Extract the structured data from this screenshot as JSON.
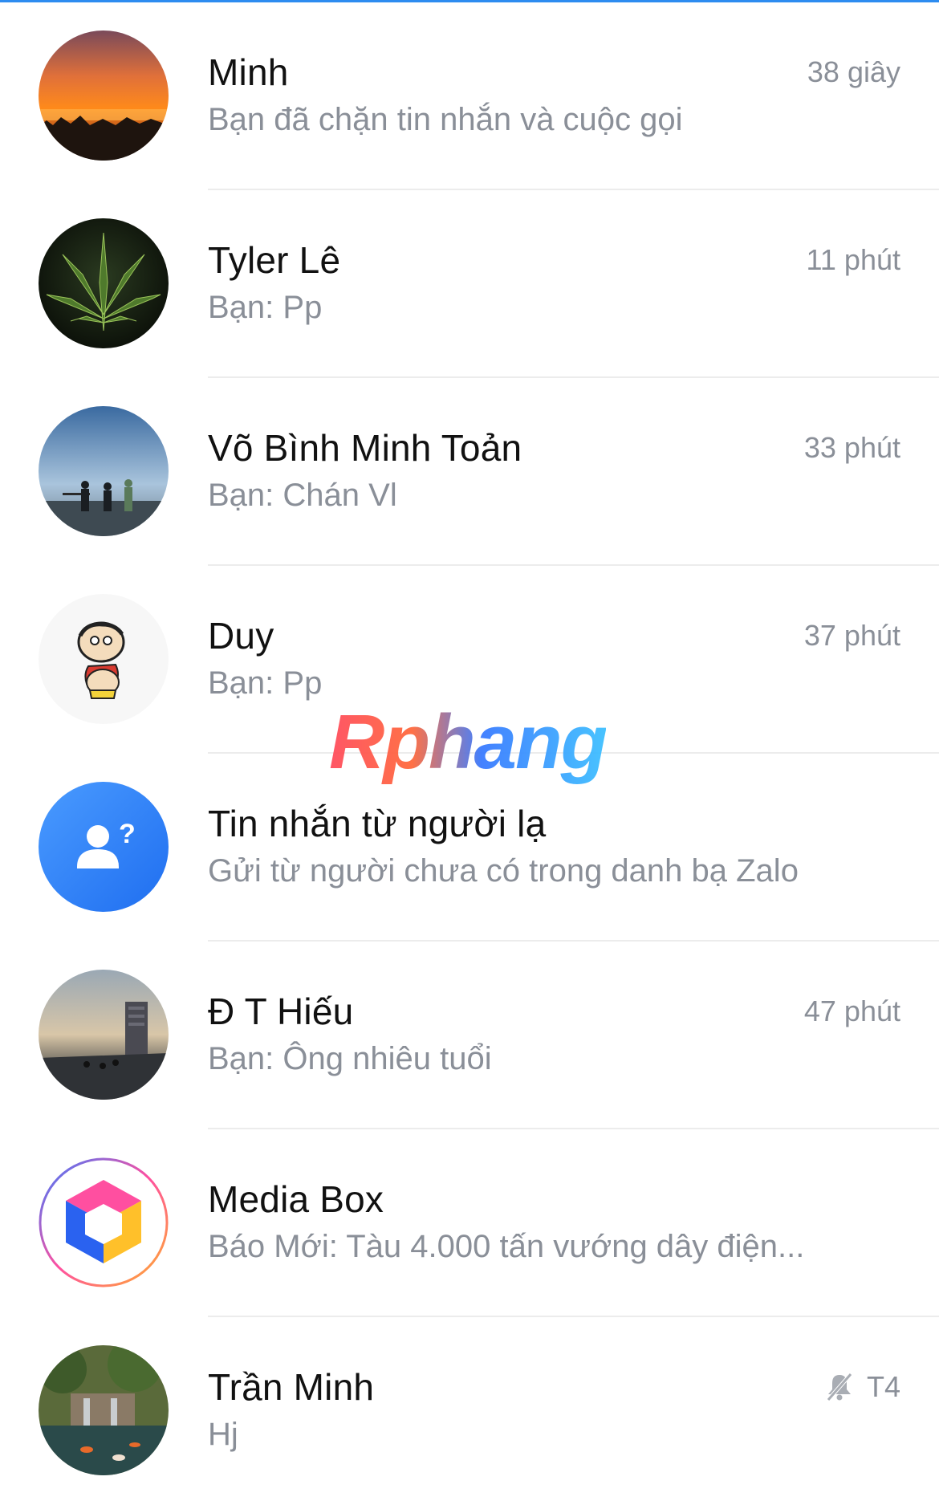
{
  "conversations": [
    {
      "name": "Minh",
      "preview": "Bạn đã chặn tin nhắn và cuộc gọi",
      "time": "38 giây",
      "avatar": "sunset-photo"
    },
    {
      "name": "Tyler Lê",
      "preview": "Bạn: Pp",
      "time": "11 phút",
      "avatar": "leaf-photo"
    },
    {
      "name": "Võ Bình Minh Toản",
      "preview": "Bạn: Chán Vl",
      "time": "33 phút",
      "avatar": "beach-people-photo"
    },
    {
      "name": "Duy",
      "preview": "Bạn: Pp",
      "time": "37 phút",
      "avatar": "cartoon-character"
    },
    {
      "name": "Tin nhắn từ người lạ",
      "preview": "Gửi từ người chưa có trong danh bạ Zalo",
      "time": "",
      "avatar": "unknown-person-icon"
    },
    {
      "name": "Đ T Hiếu",
      "preview": "Bạn: Ông nhiêu tuổi",
      "time": "47 phút",
      "avatar": "street-photo"
    },
    {
      "name": "Media Box",
      "preview": "Báo Mới: Tàu 4.000 tấn vướng dây điện...",
      "time": "",
      "avatar": "media-box-logo"
    },
    {
      "name": "Trần Minh",
      "preview": "Hj",
      "time": "T4",
      "muted": true,
      "avatar": "garden-pond-photo"
    }
  ],
  "watermark": "Rphang",
  "colors": {
    "accent": "#2d8cf0",
    "name": "#111111",
    "secondary": "#8a8f98",
    "divider": "#ececec"
  }
}
